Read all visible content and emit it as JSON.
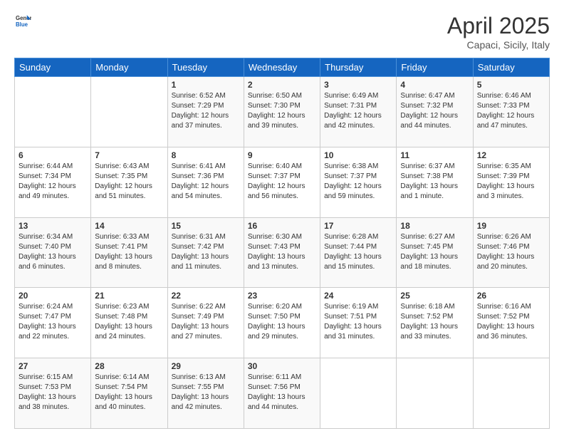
{
  "logo": {
    "general": "General",
    "blue": "Blue"
  },
  "title": "April 2025",
  "subtitle": "Capaci, Sicily, Italy",
  "weekdays": [
    "Sunday",
    "Monday",
    "Tuesday",
    "Wednesday",
    "Thursday",
    "Friday",
    "Saturday"
  ],
  "weeks": [
    [
      {
        "day": "",
        "info": ""
      },
      {
        "day": "",
        "info": ""
      },
      {
        "day": "1",
        "info": "Sunrise: 6:52 AM\nSunset: 7:29 PM\nDaylight: 12 hours\nand 37 minutes."
      },
      {
        "day": "2",
        "info": "Sunrise: 6:50 AM\nSunset: 7:30 PM\nDaylight: 12 hours\nand 39 minutes."
      },
      {
        "day": "3",
        "info": "Sunrise: 6:49 AM\nSunset: 7:31 PM\nDaylight: 12 hours\nand 42 minutes."
      },
      {
        "day": "4",
        "info": "Sunrise: 6:47 AM\nSunset: 7:32 PM\nDaylight: 12 hours\nand 44 minutes."
      },
      {
        "day": "5",
        "info": "Sunrise: 6:46 AM\nSunset: 7:33 PM\nDaylight: 12 hours\nand 47 minutes."
      }
    ],
    [
      {
        "day": "6",
        "info": "Sunrise: 6:44 AM\nSunset: 7:34 PM\nDaylight: 12 hours\nand 49 minutes."
      },
      {
        "day": "7",
        "info": "Sunrise: 6:43 AM\nSunset: 7:35 PM\nDaylight: 12 hours\nand 51 minutes."
      },
      {
        "day": "8",
        "info": "Sunrise: 6:41 AM\nSunset: 7:36 PM\nDaylight: 12 hours\nand 54 minutes."
      },
      {
        "day": "9",
        "info": "Sunrise: 6:40 AM\nSunset: 7:37 PM\nDaylight: 12 hours\nand 56 minutes."
      },
      {
        "day": "10",
        "info": "Sunrise: 6:38 AM\nSunset: 7:37 PM\nDaylight: 12 hours\nand 59 minutes."
      },
      {
        "day": "11",
        "info": "Sunrise: 6:37 AM\nSunset: 7:38 PM\nDaylight: 13 hours\nand 1 minute."
      },
      {
        "day": "12",
        "info": "Sunrise: 6:35 AM\nSunset: 7:39 PM\nDaylight: 13 hours\nand 3 minutes."
      }
    ],
    [
      {
        "day": "13",
        "info": "Sunrise: 6:34 AM\nSunset: 7:40 PM\nDaylight: 13 hours\nand 6 minutes."
      },
      {
        "day": "14",
        "info": "Sunrise: 6:33 AM\nSunset: 7:41 PM\nDaylight: 13 hours\nand 8 minutes."
      },
      {
        "day": "15",
        "info": "Sunrise: 6:31 AM\nSunset: 7:42 PM\nDaylight: 13 hours\nand 11 minutes."
      },
      {
        "day": "16",
        "info": "Sunrise: 6:30 AM\nSunset: 7:43 PM\nDaylight: 13 hours\nand 13 minutes."
      },
      {
        "day": "17",
        "info": "Sunrise: 6:28 AM\nSunset: 7:44 PM\nDaylight: 13 hours\nand 15 minutes."
      },
      {
        "day": "18",
        "info": "Sunrise: 6:27 AM\nSunset: 7:45 PM\nDaylight: 13 hours\nand 18 minutes."
      },
      {
        "day": "19",
        "info": "Sunrise: 6:26 AM\nSunset: 7:46 PM\nDaylight: 13 hours\nand 20 minutes."
      }
    ],
    [
      {
        "day": "20",
        "info": "Sunrise: 6:24 AM\nSunset: 7:47 PM\nDaylight: 13 hours\nand 22 minutes."
      },
      {
        "day": "21",
        "info": "Sunrise: 6:23 AM\nSunset: 7:48 PM\nDaylight: 13 hours\nand 24 minutes."
      },
      {
        "day": "22",
        "info": "Sunrise: 6:22 AM\nSunset: 7:49 PM\nDaylight: 13 hours\nand 27 minutes."
      },
      {
        "day": "23",
        "info": "Sunrise: 6:20 AM\nSunset: 7:50 PM\nDaylight: 13 hours\nand 29 minutes."
      },
      {
        "day": "24",
        "info": "Sunrise: 6:19 AM\nSunset: 7:51 PM\nDaylight: 13 hours\nand 31 minutes."
      },
      {
        "day": "25",
        "info": "Sunrise: 6:18 AM\nSunset: 7:52 PM\nDaylight: 13 hours\nand 33 minutes."
      },
      {
        "day": "26",
        "info": "Sunrise: 6:16 AM\nSunset: 7:52 PM\nDaylight: 13 hours\nand 36 minutes."
      }
    ],
    [
      {
        "day": "27",
        "info": "Sunrise: 6:15 AM\nSunset: 7:53 PM\nDaylight: 13 hours\nand 38 minutes."
      },
      {
        "day": "28",
        "info": "Sunrise: 6:14 AM\nSunset: 7:54 PM\nDaylight: 13 hours\nand 40 minutes."
      },
      {
        "day": "29",
        "info": "Sunrise: 6:13 AM\nSunset: 7:55 PM\nDaylight: 13 hours\nand 42 minutes."
      },
      {
        "day": "30",
        "info": "Sunrise: 6:11 AM\nSunset: 7:56 PM\nDaylight: 13 hours\nand 44 minutes."
      },
      {
        "day": "",
        "info": ""
      },
      {
        "day": "",
        "info": ""
      },
      {
        "day": "",
        "info": ""
      }
    ]
  ]
}
